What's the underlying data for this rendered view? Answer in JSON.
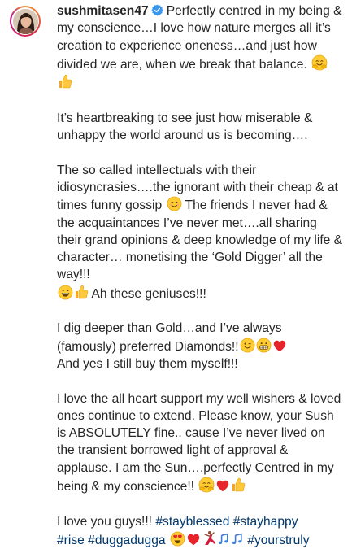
{
  "post": {
    "username": "sushmitasen47",
    "verified": true,
    "accent_color": "#00376b",
    "verified_color": "#3897f0",
    "paragraphs": [
      {
        "text": "Perfectly centred in my being & my conscience…I love how nature merges all it’s creation to experience oneness…and just how divided we are, when we break that balance.",
        "emojis": [
          "hugging-face",
          "thumbs-up"
        ]
      },
      {
        "text": "It’s heartbreaking to see just how miserable & unhappy the world around us is becoming….",
        "emojis": []
      },
      {
        "segments": [
          "The so called intellectuals with their idiosyncrasies….the ignorant with their cheap & at times funny gossip",
          "The friends I never had & the acquaintances I’ve never met….all sharing their grand opinions & deep knowledge of my life & character… monetising the ‘Gold Digger’ all the way!!!",
          "Ah these geniuses!!!"
        ]
      },
      {
        "segments": [
          "I dig deeper than Gold…and I’ve always (famously) preferred Diamonds!!",
          "And yes I still buy them myself!!!"
        ]
      },
      {
        "text": "I love the all heart support my well wishers & loved ones continue to extend. Please know, your Sush is ABSOLUTELY fine.. cause I’ve never lived on the transient borrowed light of approval & applause. I am the Sun….perfectly Centred in my being & my conscience!!",
        "emojis": [
          "hugging-face",
          "red-heart",
          "thumbs-up"
        ]
      },
      {
        "lead": "I love you guys!!!",
        "hashtags": [
          "#stayblessed",
          "#stayhappy",
          "#rise",
          "#duggadugga",
          "#yourstruly"
        ]
      }
    ]
  }
}
